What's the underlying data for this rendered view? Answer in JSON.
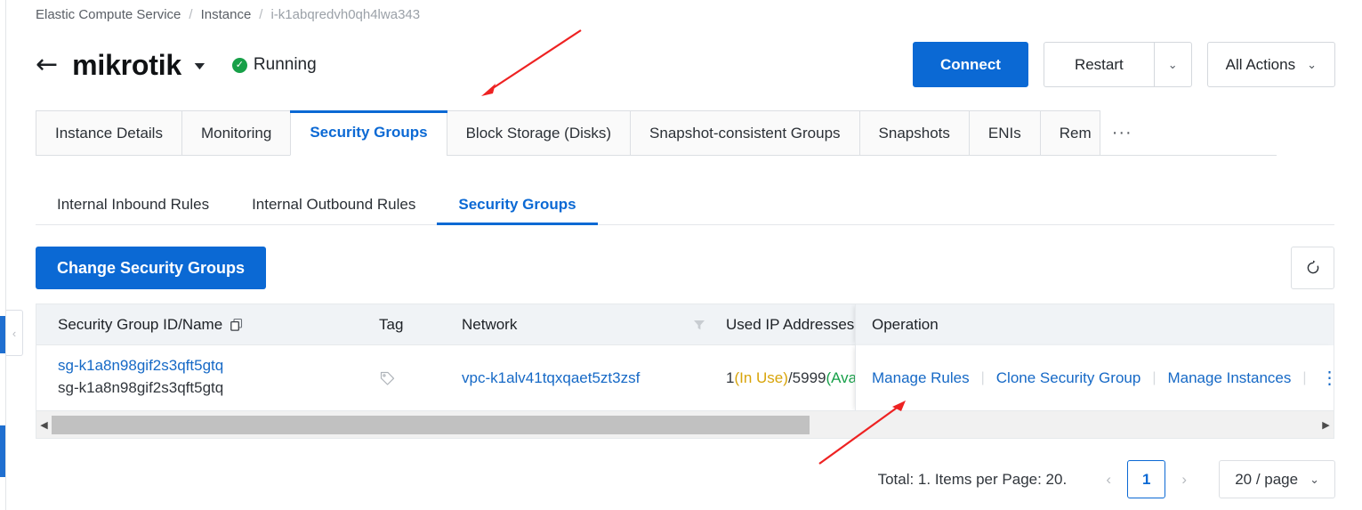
{
  "breadcrumb": {
    "items": [
      "Elastic Compute Service",
      "Instance",
      "i-k1abqredvh0qh4lwa343"
    ],
    "separator": "/"
  },
  "header": {
    "back_icon": "arrow-left-icon",
    "instance_name": "mikrotik",
    "name_caret": "▼",
    "status_label": "Running",
    "status_check": "✓",
    "status_color": "#17a048",
    "actions": {
      "connect": "Connect",
      "restart": "Restart",
      "restart_caret": "⌄",
      "all_actions": "All Actions",
      "all_actions_caret": "⌄"
    }
  },
  "main_tabs": [
    {
      "label": "Instance Details",
      "active": false
    },
    {
      "label": "Monitoring",
      "active": false
    },
    {
      "label": "Security Groups",
      "active": true
    },
    {
      "label": "Block Storage (Disks)",
      "active": false
    },
    {
      "label": "Snapshot-consistent Groups",
      "active": false
    },
    {
      "label": "Snapshots",
      "active": false
    },
    {
      "label": "ENIs",
      "active": false
    },
    {
      "label": "Rem",
      "active": false
    }
  ],
  "main_tabs_overflow": "···",
  "sub_tabs": [
    {
      "label": "Internal Inbound Rules",
      "active": false
    },
    {
      "label": "Internal Outbound Rules",
      "active": false
    },
    {
      "label": "Security Groups",
      "active": true
    }
  ],
  "toolbar": {
    "change_security_groups": "Change Security Groups",
    "refresh_icon": "refresh-icon"
  },
  "table": {
    "columns": {
      "id_name": "Security Group ID/Name",
      "id_name_copy_icon": "copy-icon",
      "tag": "Tag",
      "network": "Network",
      "network_filter_icon": "filter-icon",
      "used_ip": "Used IP Addresses",
      "operation": "Operation"
    },
    "rows": [
      {
        "sg_id": "sg-k1a8n98gif2s3qft5gtq",
        "sg_name": "sg-k1a8n98gif2s3qft5gtq",
        "tag_icon": "tag-icon",
        "network": "vpc-k1alv41tqxqaet5zt3zsf",
        "used_ip_count": "1",
        "used_ip_in_use": "(In Use)",
        "used_ip_total": "/5999",
        "used_ip_available": "(Available)",
        "operations": [
          "Manage Rules",
          "Clone Security Group",
          "Manage Instances"
        ],
        "more_icon": "more-vertical-icon"
      }
    ],
    "scrollbar": {
      "left_arrow": "◀",
      "right_arrow": "▶"
    }
  },
  "pagination": {
    "total_text": "Total: 1. Items per Page: 20.",
    "prev": "‹",
    "current_page": "1",
    "next": "›",
    "page_size": "20 / page",
    "page_size_caret": "⌄"
  },
  "left_rail": {
    "collapse_icon": "chevron-left-icon"
  },
  "annotations": {
    "arrow_color": "#ee2222",
    "arrow_1_target": "security-groups-tab",
    "arrow_2_target": "manage-rules-link"
  },
  "colors": {
    "accent": "#0b69d4",
    "link": "#1669c6",
    "running_green": "#17a048",
    "in_use_yellow": "#d8a40a",
    "available_green": "#18a04a"
  }
}
